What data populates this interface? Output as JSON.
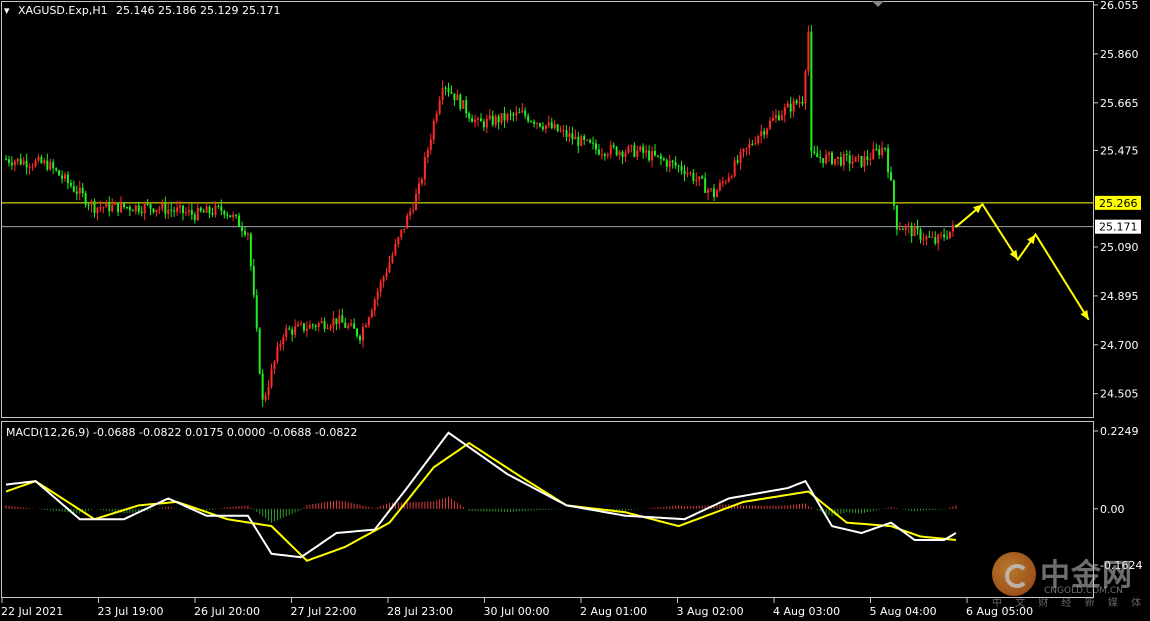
{
  "chart_data": [
    {
      "type": "candlestick",
      "title": "XAGUSD.Exp,H1",
      "ohlc_readout": "25.146 25.186 25.129 25.171",
      "y_ticks": [
        "26.055",
        "25.860",
        "25.665",
        "25.475",
        "25.090",
        "24.895",
        "24.700",
        "24.505"
      ],
      "ylim": [
        24.44,
        26.055
      ],
      "x_ticks": [
        "22 Jul 2021",
        "23 Jul 19:00",
        "26 Jul 20:00",
        "27 Jul 22:00",
        "28 Jul 23:00",
        "30 Jul 00:00",
        "2 Aug 01:00",
        "3 Aug 02:00",
        "4 Aug 03:00",
        "5 Aug 04:00",
        "6 Aug 05:00"
      ],
      "current_price_label": "25.171",
      "current_price": 25.171,
      "level_label": "25.266",
      "level": 25.266,
      "anchors": [
        [
          0,
          25.44
        ],
        [
          14,
          25.42
        ],
        [
          30,
          25.25
        ],
        [
          50,
          25.25
        ],
        [
          64,
          25.22
        ],
        [
          74,
          25.24
        ],
        [
          82,
          25.15
        ],
        [
          87,
          24.47
        ],
        [
          94,
          24.75
        ],
        [
          112,
          24.8
        ],
        [
          120,
          24.74
        ],
        [
          140,
          25.32
        ],
        [
          148,
          25.75
        ],
        [
          160,
          25.58
        ],
        [
          175,
          25.62
        ],
        [
          200,
          25.48
        ],
        [
          215,
          25.47
        ],
        [
          230,
          25.4
        ],
        [
          240,
          25.3
        ],
        [
          255,
          25.54
        ],
        [
          262,
          25.62
        ],
        [
          270,
          25.68
        ],
        [
          272,
          25.95
        ],
        [
          273,
          25.45
        ],
        [
          290,
          25.43
        ],
        [
          298,
          25.49
        ],
        [
          302,
          25.18
        ],
        [
          315,
          25.11
        ],
        [
          322,
          25.17
        ]
      ],
      "candles_count": 322,
      "forecast_arrow": {
        "color": "#ffff00",
        "path": [
          [
            322,
            25.17
          ],
          [
            331,
            25.26
          ],
          [
            343,
            25.04
          ],
          [
            349,
            25.14
          ],
          [
            367,
            24.8
          ]
        ]
      },
      "line_colors": {
        "level": "#ffff00",
        "current": "#9aa6b0",
        "bull": "#ff2a2a",
        "bear": "#22ee22"
      }
    },
    {
      "type": "macd",
      "title": "MACD(12,26,9) -0.0688 -0.0822 0.0175 0.0000 -0.0688 -0.0822",
      "y_ticks": [
        "0.2249",
        "0.00",
        "-0.1624"
      ],
      "ylim": [
        -0.1624,
        0.2249
      ],
      "main_anchors": [
        [
          0,
          0.07
        ],
        [
          10,
          0.08
        ],
        [
          25,
          -0.03
        ],
        [
          40,
          -0.03
        ],
        [
          55,
          0.03
        ],
        [
          68,
          -0.02
        ],
        [
          82,
          -0.02
        ],
        [
          90,
          -0.13
        ],
        [
          100,
          -0.14
        ],
        [
          112,
          -0.07
        ],
        [
          125,
          -0.06
        ],
        [
          135,
          0.05
        ],
        [
          150,
          0.22
        ],
        [
          160,
          0.16
        ],
        [
          170,
          0.1
        ],
        [
          190,
          0.01
        ],
        [
          210,
          -0.02
        ],
        [
          230,
          -0.03
        ],
        [
          245,
          0.03
        ],
        [
          265,
          0.06
        ],
        [
          271,
          0.08
        ],
        [
          280,
          -0.05
        ],
        [
          290,
          -0.07
        ],
        [
          300,
          -0.04
        ],
        [
          308,
          -0.09
        ],
        [
          318,
          -0.09
        ],
        [
          322,
          -0.07
        ]
      ],
      "signal_anchors": [
        [
          0,
          0.05
        ],
        [
          10,
          0.08
        ],
        [
          30,
          -0.03
        ],
        [
          45,
          0.01
        ],
        [
          58,
          0.02
        ],
        [
          75,
          -0.03
        ],
        [
          90,
          -0.05
        ],
        [
          102,
          -0.15
        ],
        [
          115,
          -0.11
        ],
        [
          130,
          -0.04
        ],
        [
          145,
          0.12
        ],
        [
          157,
          0.19
        ],
        [
          175,
          0.09
        ],
        [
          190,
          0.01
        ],
        [
          210,
          -0.01
        ],
        [
          228,
          -0.05
        ],
        [
          250,
          0.02
        ],
        [
          272,
          0.05
        ],
        [
          285,
          -0.04
        ],
        [
          300,
          -0.05
        ],
        [
          310,
          -0.08
        ],
        [
          322,
          -0.09
        ]
      ],
      "colors": {
        "main": "#ffffff",
        "signal": "#ffff00",
        "hist_pos": "#e03c3c",
        "hist_neg": "#2e9a2e"
      }
    }
  ],
  "watermark": {
    "title": "中金网",
    "sub": "中 文 财 经 新 媒 体",
    "site": "CNGOLD.COM.CN"
  }
}
